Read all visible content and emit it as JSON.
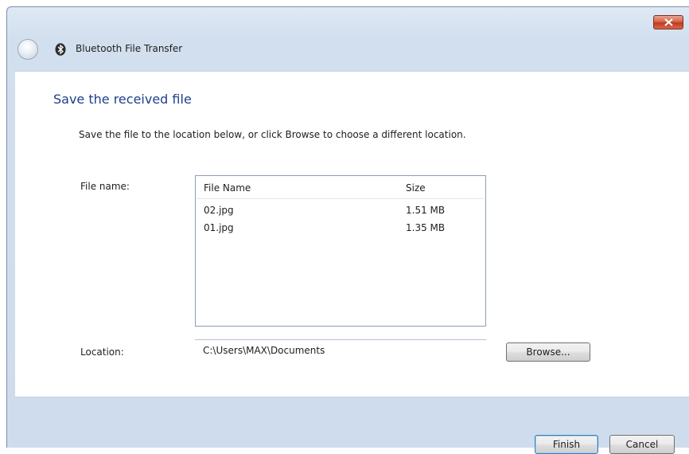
{
  "window": {
    "title": "Bluetooth File Transfer",
    "accent_color": "#1e3f8a"
  },
  "content": {
    "heading": "Save the received file",
    "instruction": "Save the file to the location below, or click Browse to choose a different location.",
    "file_name_label": "File name:",
    "location_label": "Location:",
    "location_value": "C:\\Users\\MAX\\Documents"
  },
  "file_list": {
    "columns": [
      "File Name",
      "Size"
    ],
    "rows": [
      {
        "name": "02.jpg",
        "size": "1.51 MB"
      },
      {
        "name": "01.jpg",
        "size": "1.35 MB"
      }
    ]
  },
  "buttons": {
    "browse": "Browse...",
    "finish": "Finish",
    "cancel": "Cancel"
  },
  "icons": {
    "back": "back-arrow-icon",
    "bluetooth": "bluetooth-icon",
    "close": "close-icon"
  }
}
